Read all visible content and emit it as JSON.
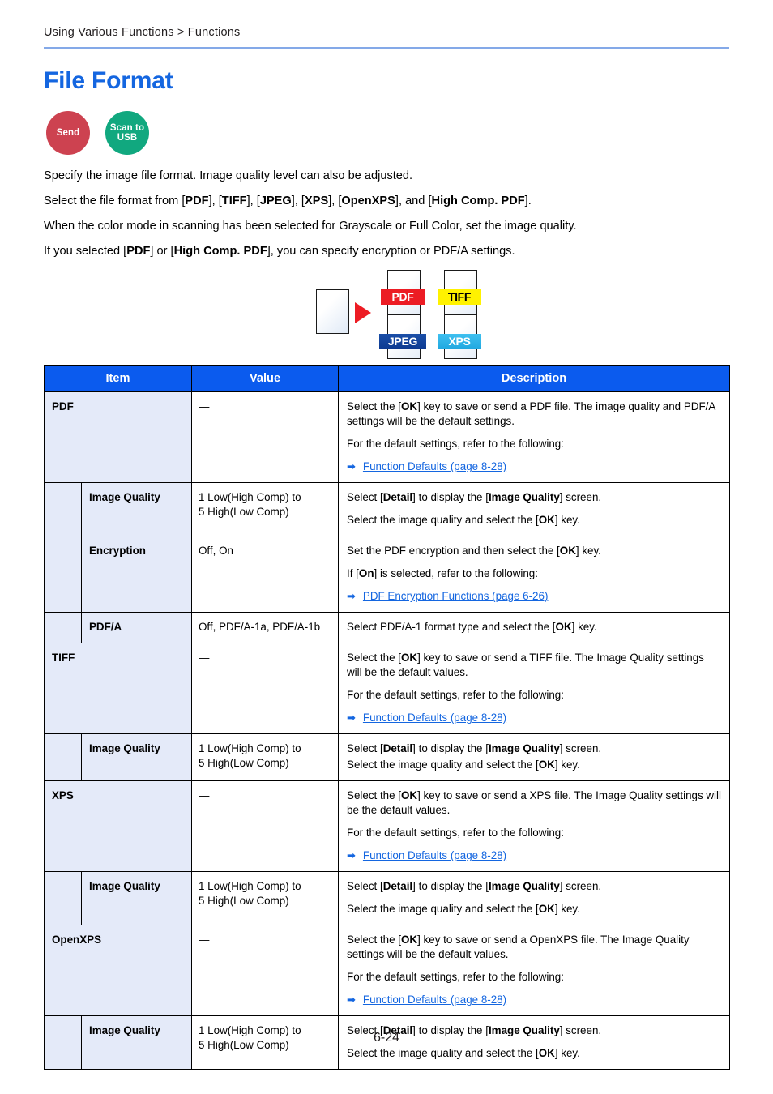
{
  "header": {
    "breadcrumb": "Using Various Functions > Functions"
  },
  "title": "File Format",
  "badges": [
    {
      "name": "send-badge",
      "line1": "Send",
      "line2": "",
      "color": "#cd4250"
    },
    {
      "name": "scan-to-usb-badge",
      "line1": "Scan to",
      "line2": "USB",
      "color": "#11a87f"
    }
  ],
  "intro": {
    "p1": "Specify the image file format. Image quality level can also be adjusted.",
    "p2_pre": "Select the file format from [",
    "p2_pdf": "PDF",
    "p2_a": "], [",
    "p2_tiff": "TIFF",
    "p2_b": "], [",
    "p2_jpeg": "JPEG",
    "p2_c": "], [",
    "p2_xps": "XPS",
    "p2_d": "], [",
    "p2_openxps": "OpenXPS",
    "p2_e": "], and [",
    "p2_hcpdf": "High Comp. PDF",
    "p2_end": "].",
    "p3": "When the color mode in scanning has been selected for Grayscale or Full Color, set the image quality.",
    "p4_pre": "If you selected [",
    "p4_pdf": "PDF",
    "p4_mid": "] or [",
    "p4_hcpdf": "High Comp. PDF",
    "p4_end": "], you can specify encryption or PDF/A settings."
  },
  "illustration": {
    "source_page_label": "source-document",
    "arrow": "red-right-arrow",
    "formats": [
      {
        "label": "PDF",
        "bg": "#ec1c24",
        "fg": "#ffffff"
      },
      {
        "label": "TIFF",
        "bg": "#fff200",
        "fg": "#000000"
      },
      {
        "label": "JPEG",
        "bg": "#1b4fa8",
        "fg": "#ffffff"
      },
      {
        "label": "XPS",
        "bg": "#3fc0f0",
        "fg": "#ffffff"
      }
    ]
  },
  "table": {
    "headers": {
      "item": "Item",
      "value": "Value",
      "description": "Description"
    },
    "rows": [
      {
        "item": "PDF",
        "value": "—",
        "desc": [
          {
            "type": "text",
            "pre": "Select the [",
            "b": "OK",
            "post": "] key to save or send a PDF file. The image quality and PDF/A settings will be the default settings."
          },
          {
            "type": "plain",
            "text": "For the default settings, refer to the following:"
          },
          {
            "type": "link",
            "text": "Function Defaults (page 8-28)"
          }
        ]
      },
      {
        "item": "Image Quality",
        "sub": true,
        "value": "1 Low(High Comp) to\n5 High(Low Comp)",
        "desc": [
          {
            "type": "detail",
            "pre": "Select [",
            "b1": "Detail",
            "mid": "] to display the [",
            "b2": "Image Quality",
            "post": "] screen."
          },
          {
            "type": "text",
            "pre": "Select the image quality and select the [",
            "b": "OK",
            "post": "] key."
          }
        ]
      },
      {
        "item": "Encryption",
        "sub": true,
        "value": "Off, On",
        "desc": [
          {
            "type": "text",
            "pre": "Set the PDF encryption and then select the [",
            "b": "OK",
            "post": "] key."
          },
          {
            "type": "text",
            "pre": "If [",
            "b": "On",
            "post": "] is selected, refer to the following:"
          },
          {
            "type": "link",
            "text": "PDF Encryption Functions (page 6-26)"
          }
        ]
      },
      {
        "item": "PDF/A",
        "sub": true,
        "value": "Off, PDF/A-1a, PDF/A-1b",
        "desc": [
          {
            "type": "text",
            "pre": "Select PDF/A-1 format type and select the [",
            "b": "OK",
            "post": "] key."
          }
        ]
      },
      {
        "item": "TIFF",
        "value": "—",
        "desc": [
          {
            "type": "text",
            "pre": "Select the [",
            "b": "OK",
            "post": "] key to save or send a TIFF file. The Image Quality settings will be the default values."
          },
          {
            "type": "plain",
            "text": "For the default settings, refer to the following:"
          },
          {
            "type": "link",
            "text": "Function Defaults (page 8-28)"
          }
        ]
      },
      {
        "item": "Image Quality",
        "sub": true,
        "tight": true,
        "value": "1 Low(High Comp) to\n5 High(Low Comp)",
        "desc": [
          {
            "type": "detail",
            "pre": "Select [",
            "b1": "Detail",
            "mid": "] to display the [",
            "b2": "Image Quality",
            "post": "] screen."
          },
          {
            "type": "text",
            "pre": "Select the image quality and select the [",
            "b": "OK",
            "post": "] key."
          }
        ]
      },
      {
        "item": "XPS",
        "value": "—",
        "desc": [
          {
            "type": "text",
            "pre": "Select the [",
            "b": "OK",
            "post": "] key to save or send a XPS file. The Image Quality settings will be the default values."
          },
          {
            "type": "plain",
            "text": "For the default settings, refer to the following:"
          },
          {
            "type": "link",
            "text": "Function Defaults (page 8-28)"
          }
        ]
      },
      {
        "item": "Image Quality",
        "sub": true,
        "value": "1 Low(High Comp) to\n5 High(Low Comp)",
        "desc": [
          {
            "type": "detail",
            "pre": "Select [",
            "b1": "Detail",
            "mid": "] to display the [",
            "b2": "Image Quality",
            "post": "] screen."
          },
          {
            "type": "text",
            "pre": "Select the image quality and select the [",
            "b": "OK",
            "post": "] key."
          }
        ]
      },
      {
        "item": "OpenXPS",
        "value": "—",
        "desc": [
          {
            "type": "text",
            "pre": "Select the [",
            "b": "OK",
            "post": "] key to save or send a OpenXPS file. The Image Quality settings will be the default values."
          },
          {
            "type": "plain",
            "text": "For the default settings, refer to the following:"
          },
          {
            "type": "link",
            "text": "Function Defaults (page 8-28)"
          }
        ]
      },
      {
        "item": "Image Quality",
        "sub": true,
        "value": "1 Low(High Comp) to\n5 High(Low Comp)",
        "desc": [
          {
            "type": "detail",
            "pre": "Select [",
            "b1": "Detail",
            "mid": "] to display the [",
            "b2": "Image Quality",
            "post": "] screen."
          },
          {
            "type": "text",
            "pre": "Select the image quality and select the [",
            "b": "OK",
            "post": "] key."
          }
        ]
      }
    ]
  },
  "footer": {
    "page_number": "6-24"
  },
  "colors": {
    "accent_blue": "#1466e0",
    "header_blue": "#0b5bee",
    "rule_blue": "#84a9e8",
    "cell_tint": "#e4eaf9"
  }
}
